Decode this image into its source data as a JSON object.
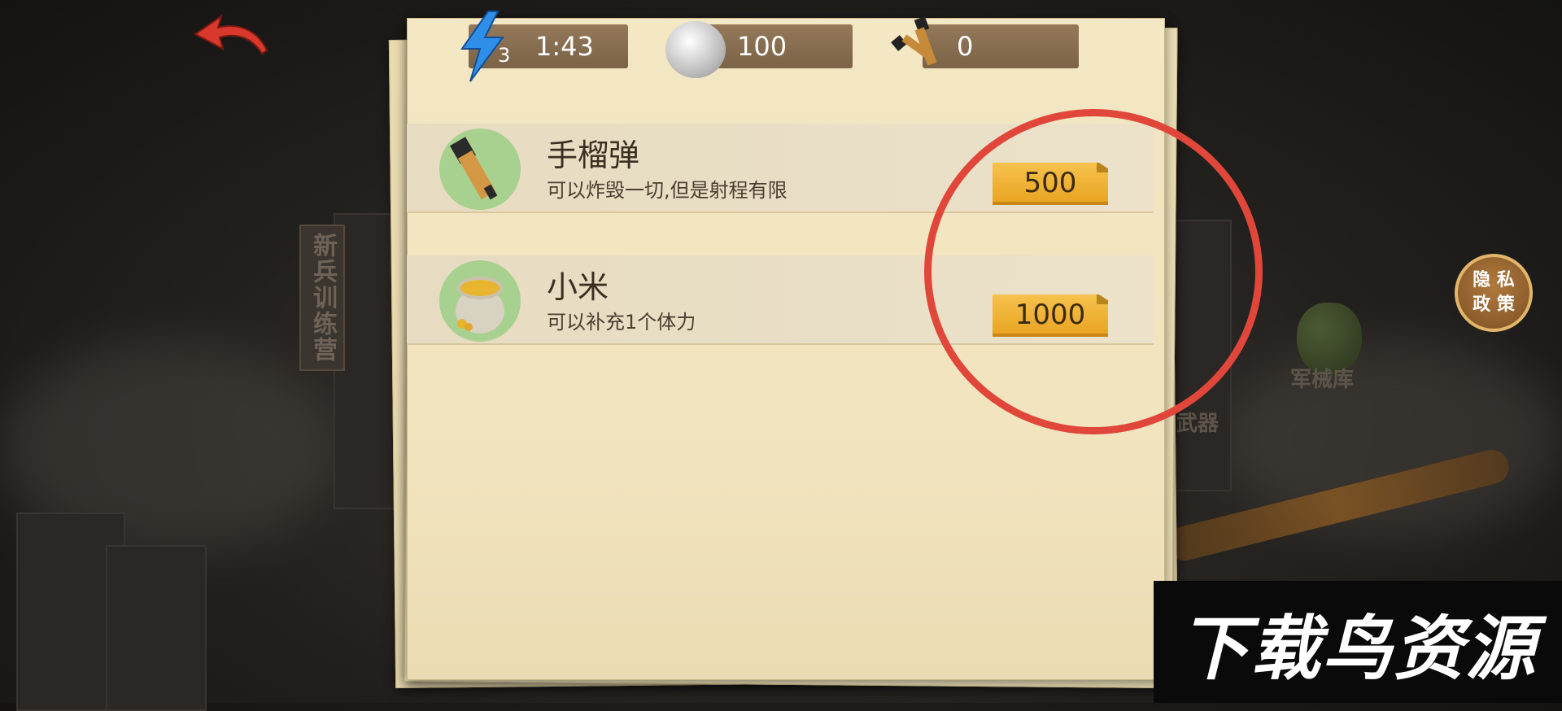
{
  "resources": {
    "energy": {
      "icon": "lightning-icon",
      "count": "3",
      "timer": "1:43"
    },
    "silver": {
      "icon": "silver-coin-icon",
      "value": "100"
    },
    "grenades": {
      "icon": "grenade-pair-icon",
      "value": "0"
    }
  },
  "background": {
    "sign_text": "新兵训练营",
    "armory_label": "军械库",
    "right_sign": "武器"
  },
  "shop_items": [
    {
      "name": "手榴弹",
      "description": "可以炸毁一切,但是射程有限",
      "price": "500",
      "icon": "grenade-icon"
    },
    {
      "name": "小米",
      "description": "可以补充1个体力",
      "price": "1000",
      "icon": "millet-sack-icon"
    }
  ],
  "privacy": {
    "line1": "隐 私",
    "line2": "政 策"
  },
  "watermark": "下载鸟资源",
  "colors": {
    "accent_red": "#e0473a",
    "price_gold": "#f0b436",
    "paper": "#f1e3bd"
  }
}
